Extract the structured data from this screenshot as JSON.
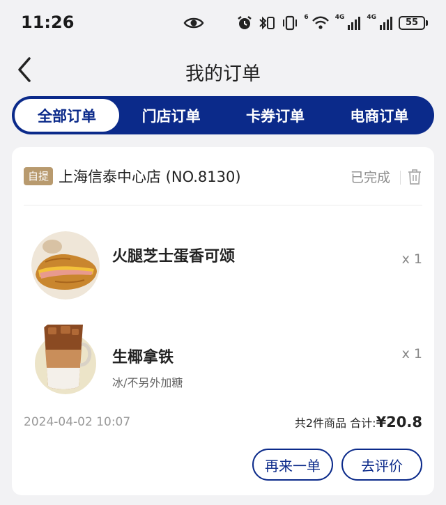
{
  "status_bar": {
    "time": "11:26",
    "battery": "55",
    "net1": "4G",
    "net2": "4G",
    "wifi_label": "6"
  },
  "header": {
    "title": "我的订单"
  },
  "tabs": [
    {
      "label": "全部订单",
      "active": true
    },
    {
      "label": "门店订单",
      "active": false
    },
    {
      "label": "卡券订单",
      "active": false
    },
    {
      "label": "电商订单",
      "active": false
    }
  ],
  "order": {
    "badge": "自提",
    "store": "上海信泰中心店 (NO.8130)",
    "status": "已完成",
    "items": [
      {
        "name": "火腿芝士蛋香可颂",
        "spec": "",
        "qty": "x 1"
      },
      {
        "name": "生椰拿铁",
        "spec": "冰/不另外加糖",
        "qty": "x 1"
      }
    ],
    "time": "2024-04-02 10:07",
    "count_text": "共2件商品",
    "total_label": "合计:",
    "total": "¥20.8",
    "buttons": {
      "reorder": "再来一单",
      "review": "去评价"
    }
  },
  "colors": {
    "brand": "#0b2a8a",
    "badge": "#b89a6e",
    "background": "#f2f2f4"
  }
}
